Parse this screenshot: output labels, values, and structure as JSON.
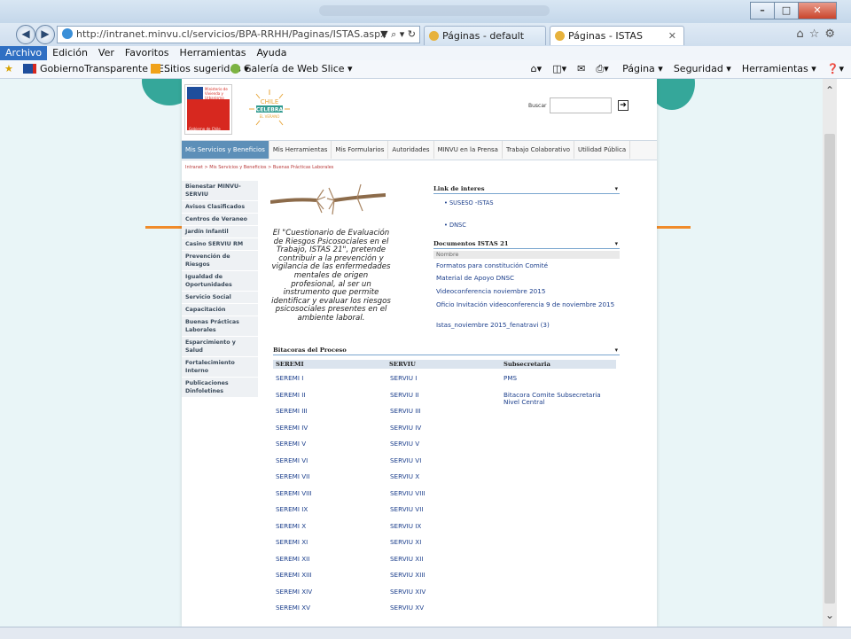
{
  "browser": {
    "address": "http://intranet.minvu.cl/servicios/BPA-RRHH/Paginas/ISTAS.aspx",
    "address_tools": "▼ ⌕ ▾ ↻",
    "tabs": [
      {
        "label": "Páginas - default"
      },
      {
        "label": "Páginas - ISTAS"
      }
    ],
    "menu": [
      "Archivo",
      "Edición",
      "Ver",
      "Favoritos",
      "Herramientas",
      "Ayuda"
    ],
    "favorites": [
      "GobiernoTransparente - E...",
      "Sitios sugeridos ▾",
      "Galería de Web Slice ▾"
    ],
    "commands": [
      "Página ▾",
      "Seguridad ▾",
      "Herramientas ▾"
    ]
  },
  "colors": {
    "accent": "#5d8fb8",
    "teal": "#35a79a",
    "orange": "#f08b2a",
    "link": "#1c3f8c"
  },
  "header": {
    "search_label": "Buscar",
    "celebra": [
      "CHILE",
      "CELEBRA",
      "EL VERANO"
    ]
  },
  "topnav": [
    "Mis Servicios y Beneficios",
    "Mis Herramientas",
    "Mis Formularios",
    "Autoridades",
    "MINVU en la Prensa",
    "Trabajo Colaborativo",
    "Utilidad Pública"
  ],
  "breadcrumb": "Intranet > Mis Servicios y Beneficios > Buenas Prácticas Laborales",
  "leftnav": [
    "Bienestar MINVU-SERVIU",
    "Avisos Clasificados",
    "Centros de Veraneo",
    "Jardín Infantil",
    "Casino SERVIU RM",
    "Prevención de Riesgos",
    "Igualdad de Oportunidades",
    "Servicio Social",
    "Capacitación",
    "Buenas Prácticas Laborales",
    "Esparcimiento y Salud",
    "Fortalecimiento Interno",
    "Publicaciones Dinfoletines"
  ],
  "quote": "El \"Cuestionario de Evaluación de Riesgos Psicosociales en el Trabajo, ISTAS 21\", pretende contribuir a la prevención y vigilancia de las enfermedades mentales de origen profesional, al ser un instrumento que permite identificar y evaluar los riesgos psicosociales presentes en el ambiente laboral.",
  "links_of_interest": {
    "title": "Link de interes",
    "items": [
      "SUSESO -ISTAS",
      "DNSC"
    ]
  },
  "documents": {
    "title": "Documentos ISTAS 21",
    "column": "Nombre",
    "items": [
      "Formatos para constitución Comité",
      "Material de Apoyo DNSC",
      "Videoconferencia noviembre 2015",
      "Oficio Invitación videoconferencia 9 de noviembre 2015",
      "Istas_noviembre 2015_fenatravi (3)"
    ]
  },
  "bitacoras": {
    "title": "Bitacoras del Proceso",
    "headers": [
      "SEREMI",
      "SERVIU",
      "Subsecretaria"
    ],
    "seremi": [
      "SEREMI I",
      "SEREMI II",
      "SEREMI III",
      "SEREMI IV",
      "SEREMI V",
      "SEREMI VI",
      "SEREMI VII",
      "SEREMI VIII",
      "SEREMI IX",
      "SEREMI X",
      "SEREMI XI",
      "SEREMI XII",
      "SEREMI XIII",
      "SEREMI XIV",
      "SEREMI XV"
    ],
    "serviu": [
      "SERVIU I",
      "SERVIU II",
      "SERVIU III",
      "SERVIU IV",
      "SERVIU V",
      "SERVIU VI",
      "SERVIU X",
      "SERVIU VIII",
      "SERVIU VII",
      "SERVIU IX",
      "SERVIU XI",
      "SERVIU XII",
      "SERVIU XIII",
      "SERVIU XIV",
      "SERVIU XV"
    ],
    "subsecretaria": [
      "PMS",
      "Bitacora Comite Subsecretaria Nivel Central"
    ]
  }
}
